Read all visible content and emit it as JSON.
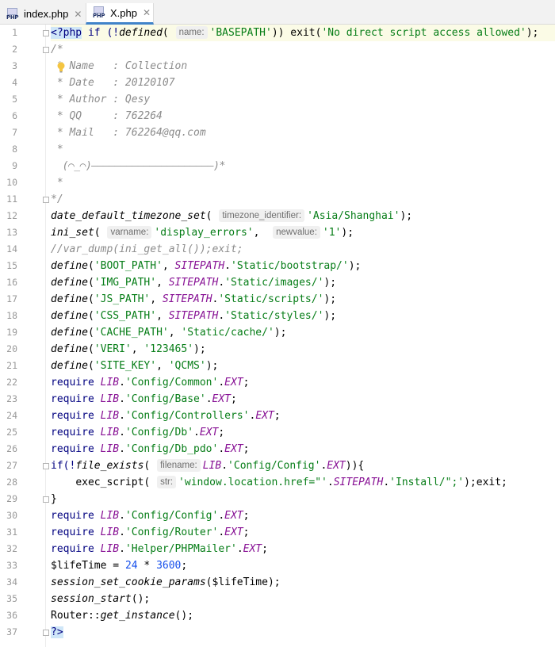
{
  "tabs": [
    {
      "label": "index.php",
      "icon": "php-file-icon",
      "active": false
    },
    {
      "label": "X.php",
      "icon": "php-file-icon",
      "active": true
    }
  ],
  "icon_label": "PHP",
  "close_glyph": "✕",
  "line_numbers": [
    "1",
    "2",
    "3",
    "4",
    "5",
    "6",
    "7",
    "8",
    "9",
    "10",
    "11",
    "12",
    "13",
    "14",
    "15",
    "16",
    "17",
    "18",
    "19",
    "20",
    "21",
    "22",
    "23",
    "24",
    "25",
    "26",
    "27",
    "28",
    "29",
    "30",
    "31",
    "32",
    "33",
    "34",
    "35",
    "36",
    "37"
  ],
  "code": {
    "l1": {
      "open": "<?php",
      "a": " if (!",
      "fn": "defined",
      "b": "( ",
      "hint": "name:",
      "str": "'BASEPATH'",
      "c": ")) exit(",
      "str2": "'No direct script access allowed'",
      "d": ");"
    },
    "l2": "/*",
    "l3": " * Name   : Collection",
    "l4": " * Date   : 20120107",
    "l5": " * Author : Qesy",
    "l6": " * QQ     : 762264",
    "l7": " * Mail   : 762264@qq.com",
    "l8": " *",
    "l9": "  (⌒_⌒)—————————————————————)*",
    "l10": " *",
    "l11": "*/",
    "l12": {
      "fn": "date_default_timezone_set",
      "a": "( ",
      "hint": "timezone_identifier:",
      "str": "'Asia/Shanghai'",
      "b": ");"
    },
    "l13": {
      "fn": "ini_set",
      "a": "( ",
      "hint1": "varname:",
      "str1": "'display_errors'",
      "b": ",  ",
      "hint2": "newvalue:",
      "str2": "'1'",
      "c": ");"
    },
    "l14": "//var_dump(ini_get_all());exit;",
    "defines": [
      {
        "name": "'BOOT_PATH'",
        "const": "SITEPATH",
        "path": "'Static/bootstrap/'"
      },
      {
        "name": "'IMG_PATH'",
        "const": "SITEPATH",
        "path": "'Static/images/'"
      },
      {
        "name": "'JS_PATH'",
        "const": "SITEPATH",
        "path": "'Static/scripts/'"
      },
      {
        "name": "'CSS_PATH'",
        "const": "SITEPATH",
        "path": "'Static/styles/'"
      }
    ],
    "l19": {
      "fn": "define",
      "a": "(",
      "s1": "'CACHE_PATH'",
      "b": ", ",
      "s2": "'Static/cache/'",
      "c": ");"
    },
    "l20": {
      "fn": "define",
      "a": "(",
      "s1": "'VERI'",
      "b": ", ",
      "s2": "'123465'",
      "c": ");"
    },
    "l21": {
      "fn": "define",
      "a": "(",
      "s1": "'SITE_KEY'",
      "b": ", ",
      "s2": "'QCMS'",
      "c": ");"
    },
    "requires1": [
      "'Config/Common'",
      "'Config/Base'",
      "'Config/Controllers'",
      "'Config/Db'",
      "'Config/Db_pdo'"
    ],
    "require_kw": "require",
    "lib": "LIB",
    "ext": "EXT",
    "dot": ".",
    "semi": ";",
    "define_fn": "define",
    "define_open": "(",
    "comma": ", ",
    "close": ");",
    "l27": {
      "a": "if(!",
      "fn": "file_exists",
      "b": "( ",
      "hint": "filename:",
      "str": "'Config/Config'",
      "c": "))",
      "d": "{"
    },
    "l28": {
      "indent": "    ",
      "fn": "exec_script",
      "a": "( ",
      "hint": "str:",
      "s1": "'window.location.href=\"'",
      "const": "SITEPATH",
      "s2": "'Install/\";'",
      "b": ");exit;"
    },
    "l29": "}",
    "requires2": [
      "'Config/Config'",
      "'Config/Router'",
      "'Helper/PHPMailer'"
    ],
    "l33": {
      "var": "$lifeTime",
      "a": " = ",
      "n1": "24",
      "b": " * ",
      "n2": "3600",
      "c": ";"
    },
    "l34": {
      "fn": "session_set_cookie_params",
      "a": "(",
      "var": "$lifeTime",
      "b": ");"
    },
    "l35": {
      "fn": "session_start",
      "a": "();"
    },
    "l36": {
      "a": "Router::",
      "fn": "get_instance",
      "b": "();"
    },
    "l37": "?>"
  }
}
